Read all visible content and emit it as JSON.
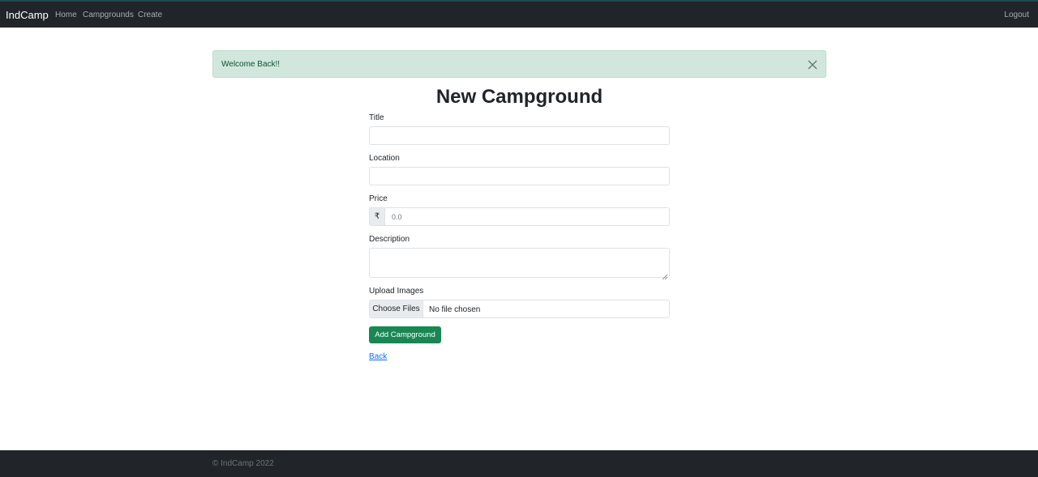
{
  "navbar": {
    "brand": "IndCamp",
    "links": [
      "Home",
      "Campgrounds",
      "Create"
    ],
    "logout": "Logout"
  },
  "alert": {
    "message": "Welcome Back!!",
    "close_icon": "close-icon"
  },
  "form": {
    "title": "New Campground",
    "fields": {
      "title_label": "Title",
      "location_label": "Location",
      "price_label": "Price",
      "price_currency": "₹",
      "price_placeholder": "0.0",
      "description_label": "Description",
      "upload_label": "Upload Images",
      "choose_files": "Choose Files",
      "no_file": "No file chosen"
    },
    "submit_label": "Add Campground",
    "back_label": "Back"
  },
  "footer": {
    "text": "© IndCamp 2022"
  },
  "colors": {
    "navbar_bg": "#212529",
    "alert_bg": "#d1e7dd",
    "submit_bg": "#198754",
    "link": "#0d6efd"
  }
}
